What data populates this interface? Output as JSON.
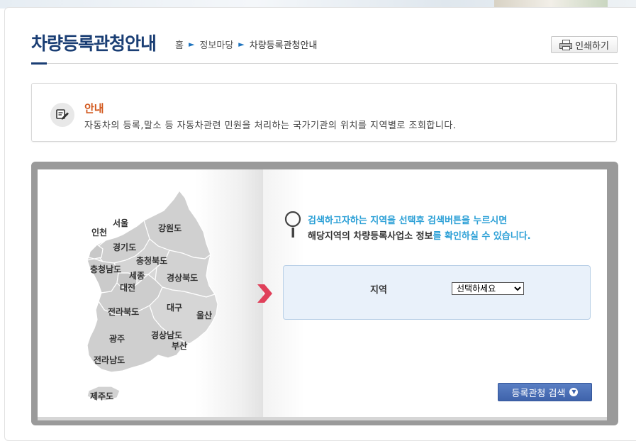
{
  "page": {
    "title": "차량등록관청안내",
    "print_label": "인쇄하기"
  },
  "breadcrumb": {
    "home": "홈",
    "section": "정보마당",
    "current": "차량등록관청안내"
  },
  "notice": {
    "title": "안내",
    "description": "자동차의 등록,말소 등 자동차관련 민원을 처리하는 국가기관의 위치를 지역별로 조회합니다."
  },
  "map": {
    "regions": [
      "서울",
      "인천",
      "강원도",
      "경기도",
      "충청북도",
      "충청남도",
      "세종",
      "대전",
      "경상북도",
      "대구",
      "울산",
      "전라북도",
      "광주",
      "경상남도",
      "부산",
      "전라남도",
      "제주도"
    ]
  },
  "search": {
    "hint_line1": "검색하고자하는 지역을 선택후 검색버튼을 누르시면",
    "hint_line2_dark": "해당지역의 차량등록사업소 정보",
    "hint_line2_blue": "를 확인하실 수 있습니다.",
    "field_label": "지역",
    "select_value": "선택하세요",
    "button_label": "등록관청 검색"
  },
  "colors": {
    "title": "#1a3e74",
    "notice_title": "#d2581d",
    "hint_blue": "#2a9fd6",
    "button": "#3f63ab",
    "arrow": "#e0405a"
  }
}
